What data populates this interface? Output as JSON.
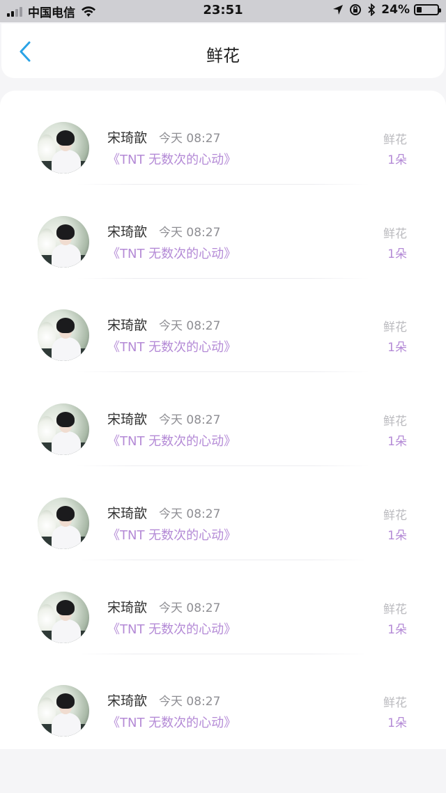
{
  "status_bar": {
    "carrier": "中国电信",
    "time": "23:51",
    "battery_percent": "24%",
    "battery_level": 0.24,
    "icons": [
      "signal-icon",
      "wifi-icon",
      "location-icon",
      "rotation-lock-icon",
      "bluetooth-icon",
      "battery-icon"
    ]
  },
  "header": {
    "title": "鲜花",
    "back_icon": "chevron-left-icon",
    "accent_color": "#2aa3e6"
  },
  "list": {
    "items": [
      {
        "name": "宋琦歆",
        "time": "今天 08:27",
        "source": "《TNT 无数次的心动》",
        "gift_type": "鲜花",
        "gift_count": "1朵"
      },
      {
        "name": "宋琦歆",
        "time": "今天 08:27",
        "source": "《TNT 无数次的心动》",
        "gift_type": "鲜花",
        "gift_count": "1朵"
      },
      {
        "name": "宋琦歆",
        "time": "今天 08:27",
        "source": "《TNT 无数次的心动》",
        "gift_type": "鲜花",
        "gift_count": "1朵"
      },
      {
        "name": "宋琦歆",
        "time": "今天 08:27",
        "source": "《TNT 无数次的心动》",
        "gift_type": "鲜花",
        "gift_count": "1朵"
      },
      {
        "name": "宋琦歆",
        "time": "今天 08:27",
        "source": "《TNT 无数次的心动》",
        "gift_type": "鲜花",
        "gift_count": "1朵"
      },
      {
        "name": "宋琦歆",
        "time": "今天 08:27",
        "source": "《TNT 无数次的心动》",
        "gift_type": "鲜花",
        "gift_count": "1朵"
      },
      {
        "name": "宋琦歆",
        "time": "今天 08:27",
        "source": "《TNT 无数次的心动》",
        "gift_type": "鲜花",
        "gift_count": "1朵"
      }
    ],
    "accent_color": "#b48ad6"
  }
}
